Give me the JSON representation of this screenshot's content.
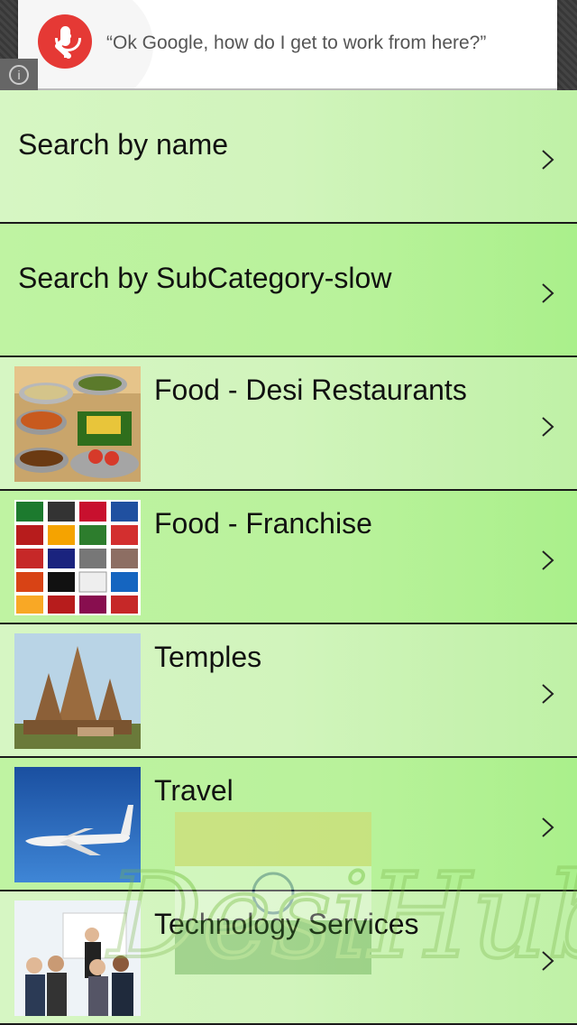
{
  "ad": {
    "text": "“Ok Google, how do I get to work from here?”",
    "icon": "microphone-icon",
    "colors": {
      "mic": "#e53935"
    }
  },
  "rows": [
    {
      "label": "Search by name",
      "icon": "chevron-right-icon"
    },
    {
      "label": "Search by SubCategory-slow",
      "icon": "chevron-right-icon"
    },
    {
      "label": "Food - Desi Restaurants",
      "thumb": "desi-food-thumbnail"
    },
    {
      "label": "Food - Franchise",
      "thumb": "franchise-logos-thumbnail"
    },
    {
      "label": "Temples",
      "thumb": "temple-thumbnail"
    },
    {
      "label": "Travel",
      "thumb": "airplane-thumbnail"
    },
    {
      "label": "Technology Services",
      "thumb": "business-people-thumbnail"
    }
  ],
  "watermark": {
    "text": "DesiHub"
  },
  "colors": {
    "row_light": "#d6f6c3",
    "row_strong": "#b9f29b",
    "divider": "#1a1a1a"
  }
}
